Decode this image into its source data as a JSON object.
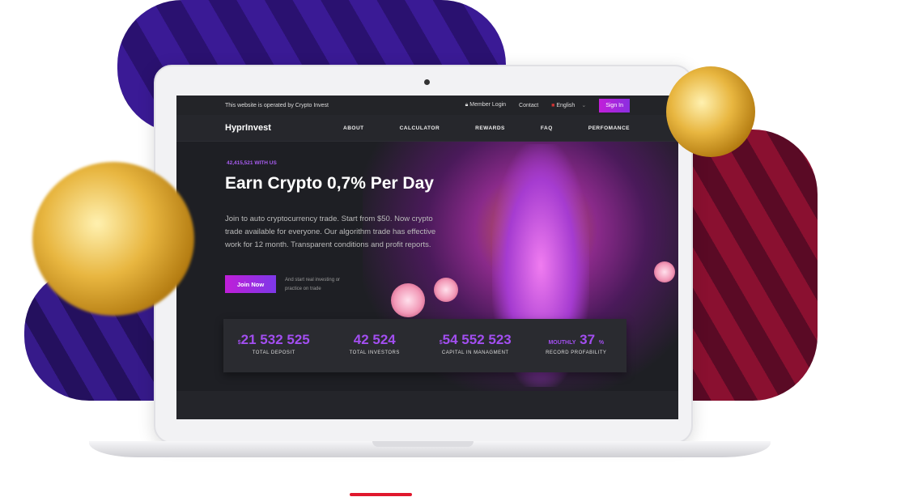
{
  "topbar": {
    "operated": "This website is operated by Crypto Invest",
    "member_login": "Member Login",
    "contact": "Contact",
    "language": "English",
    "sign_in": "Sign In"
  },
  "nav": {
    "logo": "HyprInvest",
    "items": [
      "ABOUT",
      "CALCULATOR",
      "REWARDS",
      "FAQ",
      "PERFOMANCE"
    ]
  },
  "hero": {
    "tag": "42,415,521 WITH US",
    "title": "Earn Crypto 0,7% Per Day",
    "desc": "Join to auto cryptocurrency trade. Start from $50. Now crypto trade available for everyone. Our algorithm trade has effective work for 12 month. Transparent conditions and profit reports.",
    "join": "Join Now",
    "join_note": "And start real investing or practice on trade"
  },
  "stats": [
    {
      "prefix": "$",
      "value": "21 532 525",
      "suffix": "",
      "label": "TOTAL DEPOSIT"
    },
    {
      "prefix": "",
      "value": "42 524",
      "suffix": "",
      "label": "TOTAL INVESTORS"
    },
    {
      "prefix": "$",
      "value": "54 552 523",
      "suffix": "",
      "label": "CAPITAL IN MANAGMENT"
    },
    {
      "prefix": "MOUTHLY",
      "value": "37",
      "suffix": "%",
      "label": "RECORD PROFABILITY"
    }
  ]
}
